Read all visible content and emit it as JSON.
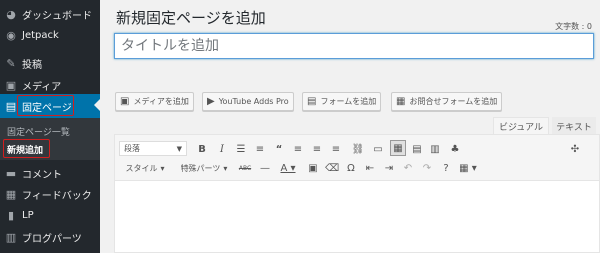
{
  "sidebar": {
    "items": [
      {
        "label": "ダッシュボード",
        "icon": "dashboard-icon",
        "glyph": "◕"
      },
      {
        "label": "Jetpack",
        "icon": "jetpack-icon",
        "glyph": "◉"
      },
      {
        "label": "投稿",
        "icon": "pin-icon",
        "glyph": "✎"
      },
      {
        "label": "メディア",
        "icon": "media-icon",
        "glyph": "▣"
      },
      {
        "label": "固定ページ",
        "icon": "pages-icon",
        "glyph": "▤"
      },
      {
        "label": "コメント",
        "icon": "comment-icon",
        "glyph": "▬"
      },
      {
        "label": "フィードバック",
        "icon": "feedback-icon",
        "glyph": "▦"
      },
      {
        "label": "LP",
        "icon": "page-icon",
        "glyph": "▮"
      },
      {
        "label": "ブログパーツ",
        "icon": "blog-parts-icon",
        "glyph": "▥"
      }
    ],
    "submenu": [
      "固定ページ一覧",
      "新規追加"
    ]
  },
  "main": {
    "title": "新規固定ページを追加",
    "char_count": "文字数 : 0",
    "title_placeholder": "タイトルを追加",
    "media_buttons": [
      {
        "label": "メディアを追加",
        "icon": "add-media-icon",
        "glyph": "▣"
      },
      {
        "label": "YouTube Adds Pro",
        "icon": "youtube-icon",
        "glyph": "▶"
      },
      {
        "label": "フォームを追加",
        "icon": "form-icon",
        "glyph": "▤"
      },
      {
        "label": "お問合せフォームを追加",
        "icon": "contact-form-icon",
        "glyph": "▦"
      }
    ],
    "tabs": {
      "visual": "ビジュアル",
      "text": "テキスト"
    },
    "toolbar": {
      "format_select": "段落",
      "style_menu": "スタイル",
      "special_menu": "特殊パーツ",
      "abc": "ABC"
    }
  }
}
